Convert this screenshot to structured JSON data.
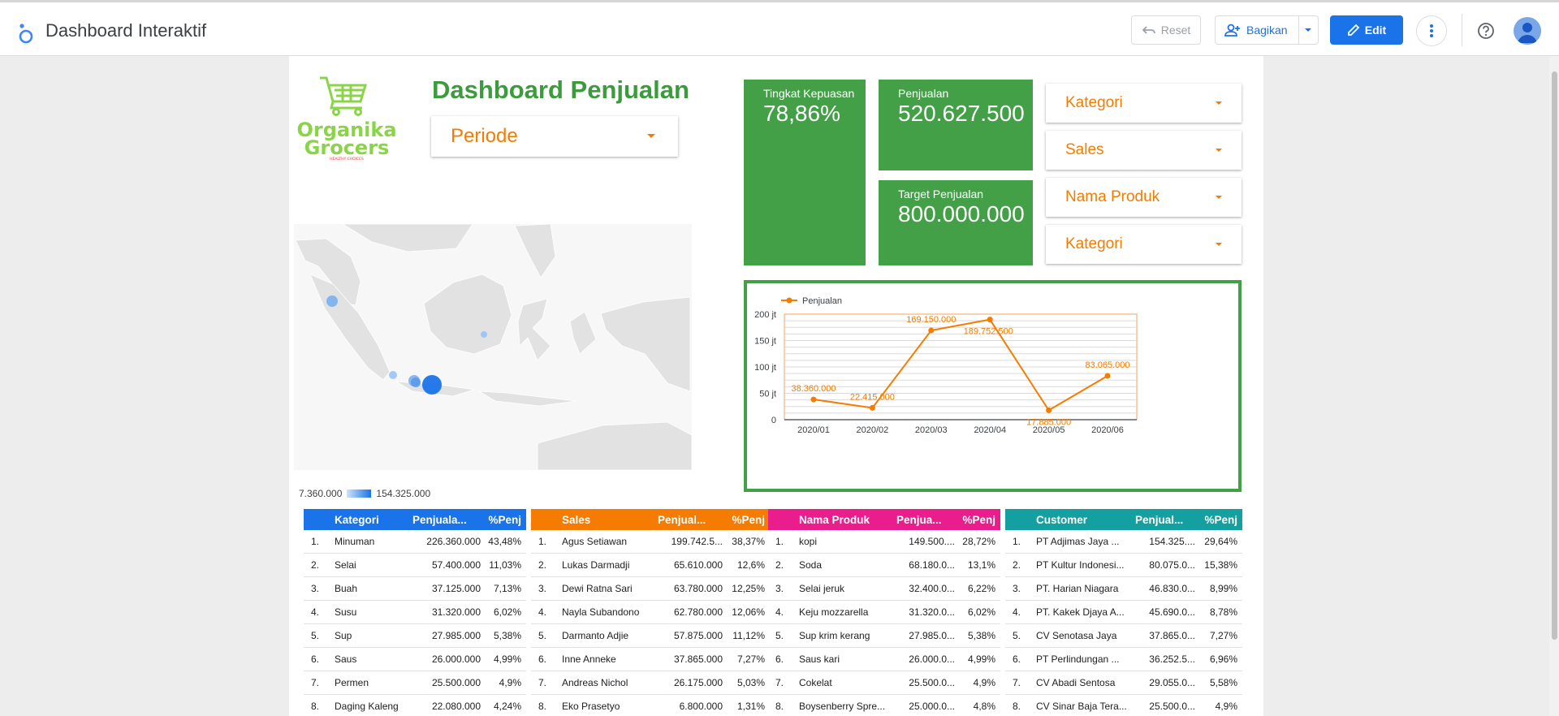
{
  "app": {
    "title": "Dashboard Interaktif",
    "reset_label": "Reset",
    "share_label": "Bagikan",
    "edit_label": "Edit"
  },
  "colors": {
    "accent_blue": "#1a73e8",
    "kpi_green": "#43a047",
    "title_green": "#3c9b3c",
    "filter_orange": "#f57c00",
    "brand_light_green": "#8bd449",
    "table_blue": "#1a73e8",
    "table_orange": "#f57c00",
    "table_pink": "#e91e8c",
    "table_teal": "#14a0a0"
  },
  "dashboard": {
    "title": "Dashboard Penjualan",
    "brand_line1": "Organika",
    "brand_line2": "Grocers",
    "brand_tagline": "HEALTHY CHOICES",
    "periode_filter": "Periode",
    "filters": [
      "Kategori",
      "Sales",
      "Nama Produk",
      "Kategori"
    ]
  },
  "kpis": [
    {
      "label": "Tingkat Kepuasan",
      "value": "78,86%"
    },
    {
      "label": "Penjualan",
      "value": "520.627.500"
    },
    {
      "label": "Target Penjualan",
      "value": "800.000.000"
    }
  ],
  "map": {
    "legend_min": "7.360.000",
    "legend_max": "154.325.000",
    "bubbles": [
      {
        "region": "Sumatera Utara",
        "intensity": 0.25
      },
      {
        "region": "Kalimantan Timur",
        "intensity": 0.15
      },
      {
        "region": "Lampung",
        "intensity": 0.1
      },
      {
        "region": "Jawa Barat",
        "intensity": 0.4
      },
      {
        "region": "Jawa Tengah",
        "intensity": 0.3
      },
      {
        "region": "Jawa Timur",
        "intensity": 1.0
      }
    ]
  },
  "chart_data": {
    "type": "line",
    "title": "",
    "series": [
      {
        "name": "Penjualan",
        "values": [
          38360000,
          22415000,
          169150000,
          189752500,
          17885000,
          83065000
        ]
      }
    ],
    "categories": [
      "2020/01",
      "2020/02",
      "2020/03",
      "2020/04",
      "2020/05",
      "2020/06"
    ],
    "data_labels": [
      "38.360.000",
      "22.415.000",
      "169.150.000",
      "189.752.500",
      "17.885.000",
      "83.065.000"
    ],
    "y_ticks": [
      "0",
      "50 jt",
      "100 jt",
      "150 jt",
      "200 jt"
    ],
    "ylim": [
      0,
      200000000
    ],
    "legend": "top-left",
    "grid": true,
    "xlabel": "",
    "ylabel": ""
  },
  "tables": [
    {
      "headers": [
        "Kategori",
        "Penjuala...",
        "%Penj"
      ],
      "rows": [
        [
          "1.",
          "Minuman",
          "226.360.000",
          "43,48%"
        ],
        [
          "2.",
          "Selai",
          "57.400.000",
          "11,03%"
        ],
        [
          "3.",
          "Buah",
          "37.125.000",
          "7,13%"
        ],
        [
          "4.",
          "Susu",
          "31.320.000",
          "6,02%"
        ],
        [
          "5.",
          "Sup",
          "27.985.000",
          "5,38%"
        ],
        [
          "6.",
          "Saus",
          "26.000.000",
          "4,99%"
        ],
        [
          "7.",
          "Permen",
          "25.500.000",
          "4,9%"
        ],
        [
          "8.",
          "Daging Kaleng",
          "22.080.000",
          "4,24%"
        ]
      ]
    },
    {
      "headers": [
        "Sales",
        "Penjual...",
        "%Penj"
      ],
      "rows": [
        [
          "1.",
          "Agus Setiawan",
          "199.742.5...",
          "38,37%"
        ],
        [
          "2.",
          "Lukas Darmadji",
          "65.610.000",
          "12,6%"
        ],
        [
          "3.",
          "Dewi Ratna Sari",
          "63.780.000",
          "12,25%"
        ],
        [
          "4.",
          "Nayla Subandono",
          "62.780.000",
          "12,06%"
        ],
        [
          "5.",
          "Darmanto Adjie",
          "57.875.000",
          "11,12%"
        ],
        [
          "6.",
          "Inne Anneke",
          "37.865.000",
          "7,27%"
        ],
        [
          "7.",
          "Andreas Nichol",
          "26.175.000",
          "5,03%"
        ],
        [
          "8.",
          "Eko Prasetyo",
          "6.800.000",
          "1,31%"
        ]
      ]
    },
    {
      "headers": [
        "Nama Produk",
        "Penjua...",
        "%Penj"
      ],
      "rows": [
        [
          "1.",
          "kopi",
          "149.500....",
          "28,72%"
        ],
        [
          "2.",
          "Soda",
          "68.180.0...",
          "13,1%"
        ],
        [
          "3.",
          "Selai jeruk",
          "32.400.0...",
          "6,22%"
        ],
        [
          "4.",
          "Keju mozzarella",
          "31.320.0...",
          "6,02%"
        ],
        [
          "5.",
          "Sup krim kerang",
          "27.985.0...",
          "5,38%"
        ],
        [
          "6.",
          "Saus kari",
          "26.000.0...",
          "4,99%"
        ],
        [
          "7.",
          "Cokelat",
          "25.500.0...",
          "4,9%"
        ],
        [
          "8.",
          "Boysenberry Spre...",
          "25.000.0...",
          "4,8%"
        ]
      ]
    },
    {
      "headers": [
        "Customer",
        "Penjual...",
        "%Penj"
      ],
      "rows": [
        [
          "1.",
          "PT Adjimas Jaya ...",
          "154.325....",
          "29,64%"
        ],
        [
          "2.",
          "PT Kultur Indonesi...",
          "80.075.0...",
          "15,38%"
        ],
        [
          "3.",
          "PT. Harian Niagara",
          "46.830.0...",
          "8,99%"
        ],
        [
          "4.",
          "PT. Kakek Djaya A...",
          "45.690.0...",
          "8,78%"
        ],
        [
          "5.",
          "CV Senotasa Jaya",
          "37.865.0...",
          "7,27%"
        ],
        [
          "6.",
          "PT Perlindungan ...",
          "36.252.5...",
          "6,96%"
        ],
        [
          "7.",
          "CV Abadi Sentosa",
          "29.055.0...",
          "5,58%"
        ],
        [
          "8.",
          "CV Sinar Baja Tera...",
          "25.500.0...",
          "4,9%"
        ]
      ]
    }
  ]
}
